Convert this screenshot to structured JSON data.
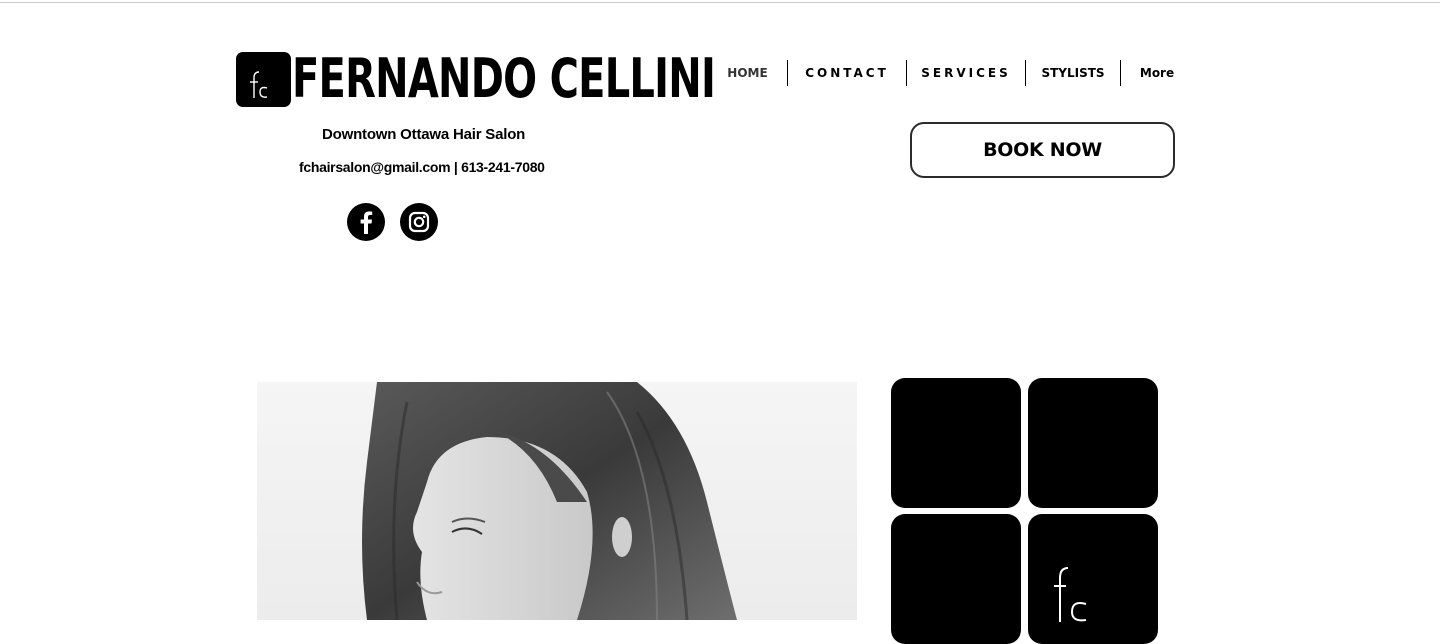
{
  "brand": {
    "logo_icon": "fc-monogram-icon",
    "name": "FERNANDO CELLINI",
    "tagline": "Downtown Ottawa Hair Salon",
    "contact": "fchairsalon@gmail.com | 613-241-7080"
  },
  "social": [
    {
      "name": "Facebook",
      "icon": "facebook-icon"
    },
    {
      "name": "Instagram",
      "icon": "instagram-icon"
    }
  ],
  "nav": {
    "items": [
      {
        "label": "HOME",
        "active": true
      },
      {
        "label": "CONTACT"
      },
      {
        "label": "SERVICES"
      },
      {
        "label": "STYLISTS"
      },
      {
        "label": "More"
      }
    ]
  },
  "cta": {
    "book_label": "BOOK NOW"
  },
  "colors": {
    "primary": "#000000",
    "background": "#ffffff",
    "nav_active": "#333333"
  }
}
